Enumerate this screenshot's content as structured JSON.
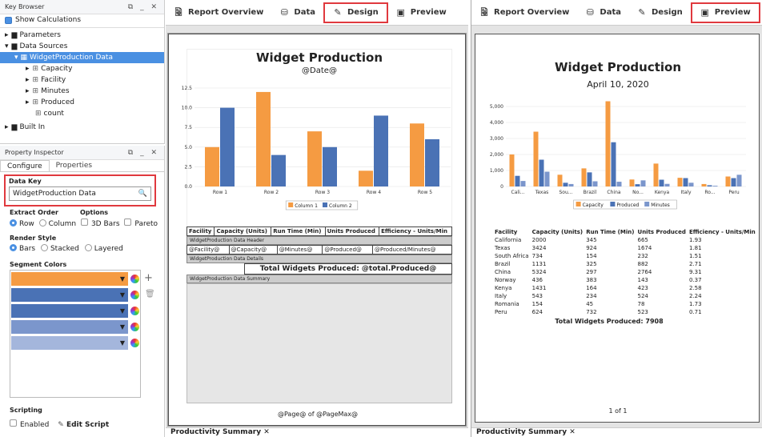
{
  "key_browser": {
    "title": "Key Browser",
    "show_calc": "Show Calculations",
    "items": [
      "Parameters",
      "Data Sources",
      "WidgetProduction Data",
      "Capacity",
      "Facility",
      "Minutes",
      "Produced",
      "count",
      "Built In"
    ]
  },
  "inspector": {
    "title": "Property Inspector",
    "tab_configure": "Configure",
    "tab_properties": "Properties",
    "data_key_label": "Data Key",
    "data_key_value": "WidgetProduction Data",
    "extract_label": "Extract Order",
    "options_label": "Options",
    "opt_row": "Row",
    "opt_column": "Column",
    "opt_3d": "3D Bars",
    "opt_pareto": "Pareto",
    "render_label": "Render Style",
    "opt_bars": "Bars",
    "opt_stacked": "Stacked",
    "opt_layered": "Layered",
    "segment_label": "Segment Colors",
    "scripting_label": "Scripting",
    "enabled": "Enabled",
    "edit_script": "Edit Script",
    "segment_colors": [
      "#f59b42",
      "#4a72b5",
      "#4a72b5",
      "#7b96cc",
      "#a4b6dc"
    ]
  },
  "tabs": {
    "overview": "Report Overview",
    "data": "Data",
    "design": "Design",
    "preview": "Preview"
  },
  "design": {
    "title": "Widget Production",
    "date": "@Date@",
    "yticks": [
      "12.5",
      "10.0",
      "7.5",
      "5.0",
      "2.5",
      "0.0"
    ],
    "legend": [
      "Column 1",
      "Column 2"
    ],
    "headers": [
      "Facility",
      "Capacity (Units)",
      "Run Time (Min)",
      "Units Produced",
      "Efficiency - Units/Min"
    ],
    "band_header": "WidgetProduction Data Header",
    "band_details": "WidgetProduction Data Details",
    "band_summary": "WidgetProduction Data Summary",
    "row": [
      "@Facility@",
      "@Capacity@",
      "@Minutes@",
      "@Produced@",
      "@Produced/Minutes@"
    ],
    "total": "Total Widgets Produced: @total.Produced@",
    "footer": "@Page@ of @PageMax@",
    "doc_tab": "Productivity Summary"
  },
  "preview": {
    "title": "Widget Production",
    "date": "April 10, 2020",
    "yticks": [
      "5,000",
      "4,000",
      "3,000",
      "2,000",
      "1,000",
      "0"
    ],
    "legend": [
      "Capacity",
      "Produced",
      "Minutes"
    ],
    "headers": [
      "Facility",
      "Capacity (Units)",
      "Run Time (Min)",
      "Units Produced",
      "Efficiency - Units/Min"
    ],
    "rows": [
      [
        "California",
        "2000",
        "345",
        "665",
        "1.93"
      ],
      [
        "Texas",
        "3424",
        "924",
        "1674",
        "1.81"
      ],
      [
        "South Africa",
        "734",
        "154",
        "232",
        "1.51"
      ],
      [
        "Brazil",
        "1131",
        "325",
        "882",
        "2.71"
      ],
      [
        "China",
        "5324",
        "297",
        "2764",
        "9.31"
      ],
      [
        "Norway",
        "436",
        "383",
        "143",
        "0.37"
      ],
      [
        "Kenya",
        "1431",
        "164",
        "423",
        "2.58"
      ],
      [
        "Italy",
        "543",
        "234",
        "524",
        "2.24"
      ],
      [
        "Romania",
        "154",
        "45",
        "78",
        "1.73"
      ],
      [
        "Peru",
        "624",
        "732",
        "523",
        "0.71"
      ]
    ],
    "total": "Total Widgets Produced: 7908",
    "footer": "1 of 1",
    "doc_tab": "Productivity Summary"
  },
  "chart_data": [
    {
      "type": "bar",
      "title": "",
      "categories": [
        "Row 1",
        "Row 2",
        "Row 3",
        "Row 4",
        "Row 5"
      ],
      "series": [
        {
          "name": "Column 1",
          "values": [
            5,
            12,
            7,
            2,
            8
          ]
        },
        {
          "name": "Column 2",
          "values": [
            10,
            4,
            5,
            9,
            6
          ]
        }
      ],
      "ylim": [
        0,
        12.5
      ],
      "colors": [
        "#f59b42",
        "#4a72b5"
      ],
      "legend": "bottom"
    },
    {
      "type": "bar",
      "title": "",
      "categories": [
        "Cali...",
        "Texas",
        "Sou...",
        "Brazil",
        "China",
        "No...",
        "Kenya",
        "Italy",
        "Ro...",
        "Peru"
      ],
      "series": [
        {
          "name": "Capacity",
          "values": [
            2000,
            3424,
            734,
            1131,
            5324,
            436,
            1431,
            543,
            154,
            624
          ]
        },
        {
          "name": "Produced",
          "values": [
            665,
            1674,
            232,
            882,
            2764,
            143,
            423,
            524,
            78,
            523
          ]
        },
        {
          "name": "Minutes",
          "values": [
            345,
            924,
            154,
            325,
            297,
            383,
            164,
            234,
            45,
            732
          ]
        }
      ],
      "ylim": [
        0,
        5000
      ],
      "colors": [
        "#f59b42",
        "#4a72b5",
        "#7b96cc"
      ],
      "legend": "bottom"
    }
  ]
}
